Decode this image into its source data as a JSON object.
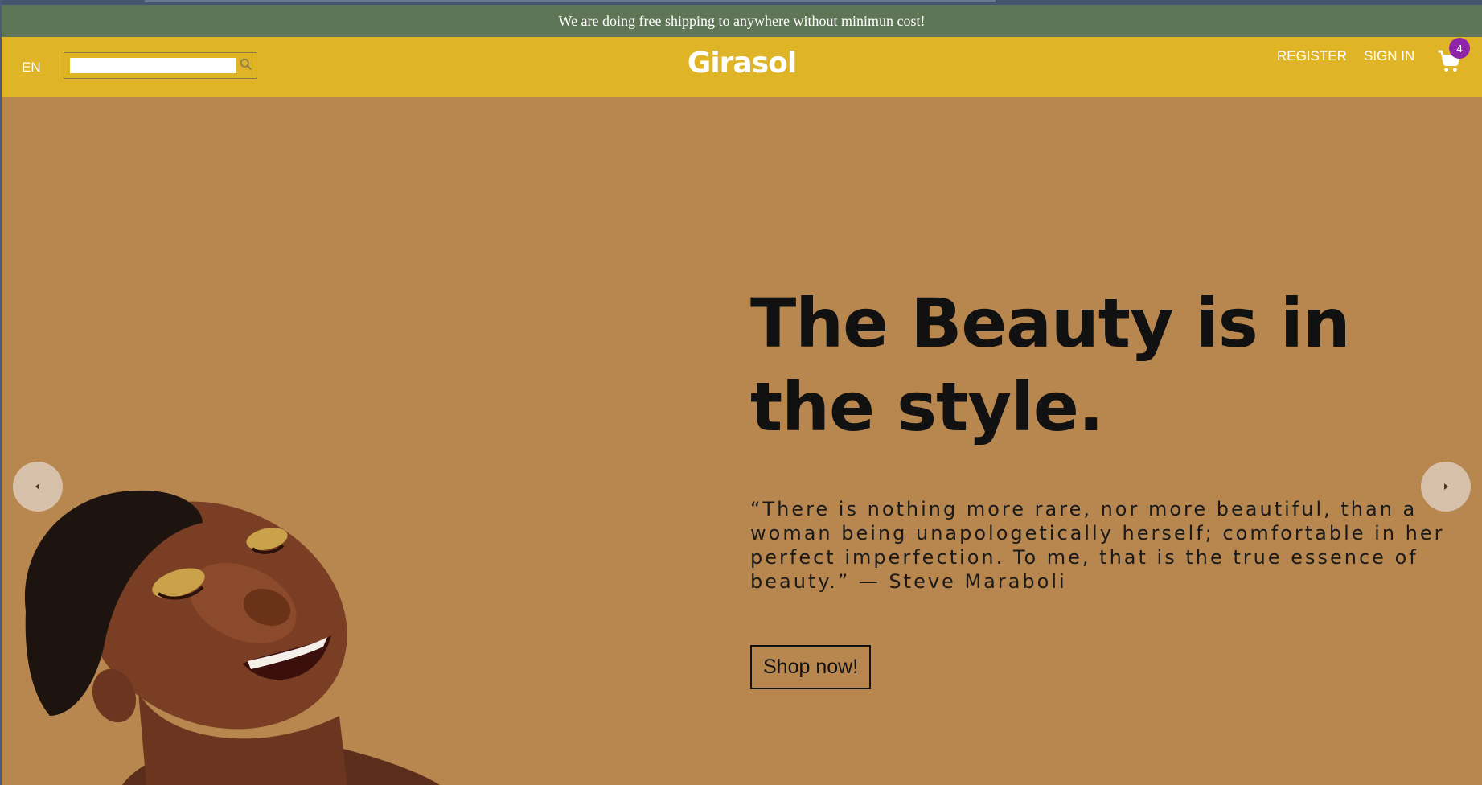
{
  "announcement": {
    "text": "We are doing free shipping to anywhere without minimun cost!"
  },
  "header": {
    "language": "EN",
    "search": {
      "value": "",
      "placeholder": ""
    },
    "brand": "Girasol",
    "register_label": "REGISTER",
    "signin_label": "SIGN IN",
    "cart_count": "4"
  },
  "hero": {
    "headline": "The Beauty is in the style.",
    "quote": "“There is nothing more rare, nor more beautiful, than a woman being unapologetically herself; comfortable in her perfect imperfection. To me, that is the true essence of beauty.” — Steve Maraboli",
    "cta_label": "Shop now!"
  },
  "icons": {
    "search": "search-icon",
    "cart": "cart-icon",
    "prev": "chevron-left-icon",
    "next": "chevron-right-icon"
  },
  "colors": {
    "announcement_bg": "#5e7556",
    "navbar_bg": "#dfb427",
    "hero_bg": "#b8874f",
    "badge_bg": "#8e24aa",
    "arrow_bg": "#d7c1ab"
  }
}
